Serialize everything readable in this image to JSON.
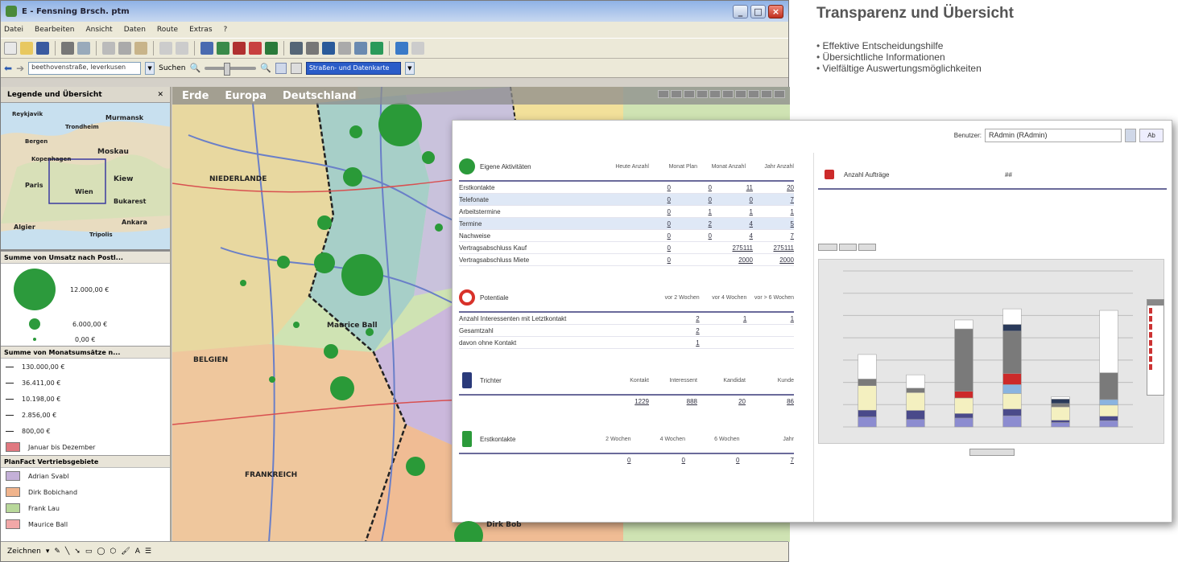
{
  "window": {
    "title": "E - Fensning Brsch. ptm",
    "menu": [
      "Datei",
      "Bearbeiten",
      "Ansicht",
      "Daten",
      "Route",
      "Extras",
      "?"
    ],
    "address_value": "beethovenstraße, leverkusen",
    "search_label": "Suchen",
    "layer_select_value": "Straßen- und Datenkarte"
  },
  "left_panel": {
    "title": "Legende und Übersicht",
    "minimap_labels": [
      "Reykjavik",
      "Murmansk",
      "Trondheim",
      "Bergen",
      "Moskau",
      "Kopenhagen",
      "Kiew",
      "Paris",
      "Wien",
      "Bukarest",
      "Algier",
      "Ankara",
      "Tripolis"
    ],
    "sections": [
      {
        "title": "Summe von Umsatz nach Postl...",
        "items": [
          {
            "label": "12.000,00 €"
          },
          {
            "label": "6.000,00 €"
          },
          {
            "label": "0,00 €"
          }
        ]
      },
      {
        "title": "Summe von Monatsumsätze n...",
        "items": [
          {
            "label": "130.000,00 €"
          },
          {
            "label": "36.411,00 €"
          },
          {
            "label": "10.198,00 €"
          },
          {
            "label": "2.856,00 €"
          },
          {
            "label": "800,00 €"
          },
          {
            "label": "Januar bis Dezember"
          }
        ]
      },
      {
        "title": "PlanFact Vertriebsgebiete",
        "items": [
          {
            "label": "Adrian Svabl",
            "color": "#c4b0d8"
          },
          {
            "label": "Dirk Bobichand",
            "color": "#f0b48c"
          },
          {
            "label": "Frank Lau",
            "color": "#b8d89a"
          },
          {
            "label": "Maurice Ball",
            "color": "#f2a8a8"
          }
        ]
      }
    ]
  },
  "map": {
    "breadcrumb": [
      "Erde",
      "Europa",
      "Deutschland"
    ],
    "labels": [
      "NIEDERLANDE",
      "BELGIEN",
      "FRANKREICH",
      "Maurice Ball",
      "Dirk Bob"
    ]
  },
  "drawbar_label": "Zeichnen",
  "heading": "Transparenz und Übersicht",
  "bullets": [
    "Effektive Entscheidungshilfe",
    "Übersichtliche Informationen",
    "Vielfältige Auswertungsmöglichkeiten"
  ],
  "dashboard": {
    "user_label": "Benutzer:",
    "user_value": "RAdmin (RAdmin)",
    "logout_label": "Ab",
    "blocks": [
      {
        "title": "Eigene Aktivitäten",
        "icon_color": "#2b9a3a",
        "columns": [
          "Heute Anzahl",
          "Monat Plan",
          "Monat Anzahl",
          "Jahr Anzahl"
        ],
        "rows": [
          {
            "label": "Erstkontakte",
            "values": [
              "0",
              "0",
              "11",
              "20"
            ]
          },
          {
            "label": "Telefonate",
            "values": [
              "0",
              "0",
              "0",
              "7"
            ]
          },
          {
            "label": "Arbeitstermine",
            "values": [
              "0",
              "1",
              "1",
              "1"
            ]
          },
          {
            "label": "Termine",
            "values": [
              "0",
              "2",
              "4",
              "5"
            ]
          },
          {
            "label": "Nachweise",
            "values": [
              "0",
              "0",
              "4",
              "7"
            ]
          },
          {
            "label": "Vertragsabschluss Kauf",
            "values": [
              "0",
              "",
              "275111",
              "275111"
            ]
          },
          {
            "label": "Vertragsabschluss Miete",
            "values": [
              "0",
              "",
              "2000",
              "2000"
            ]
          }
        ]
      },
      {
        "title": "Potentiale",
        "icon_color": "#d8322a",
        "columns": [
          "vor 2 Wochen",
          "vor 4 Wochen",
          "vor > 6 Wochen"
        ],
        "rows": [
          {
            "label": "Anzahl Interessenten mit Letztkontakt",
            "values": [
              "2",
              "1",
              "1"
            ]
          },
          {
            "label": "Gesamtzahl",
            "values": [
              "2",
              "",
              ""
            ]
          },
          {
            "label": "davon ohne Kontakt",
            "values": [
              "1",
              "",
              ""
            ]
          }
        ]
      },
      {
        "title": "Trichter",
        "icon_color": "#2a3a7a",
        "columns": [
          "Kontakt",
          "Interessent",
          "Kandidat",
          "Kunde"
        ],
        "rows": [
          {
            "label": "",
            "values": [
              "1229",
              "888",
              "20",
              "86"
            ]
          }
        ]
      },
      {
        "title": "Erstkontakte",
        "icon_color": "#2b9a3a",
        "columns": [
          "2 Wochen",
          "4 Wochen",
          "6 Wochen",
          "Jahr"
        ],
        "rows": [
          {
            "label": "",
            "values": [
              "0",
              "0",
              "0",
              "7"
            ]
          }
        ]
      }
    ],
    "chart_title": "Anzahl Aufträge",
    "chart_value": "##",
    "chart_data": {
      "type": "bar",
      "stacked": true,
      "categories": [
        "",
        "",
        "",
        "",
        "",
        ""
      ],
      "series": [
        {
          "values": [
            4500,
            3400,
            4000,
            5000,
            2000,
            2800
          ],
          "color": "#8c8cd0"
        },
        {
          "values": [
            3000,
            4000,
            2000,
            3000,
            1000,
            2000
          ],
          "color": "#4a4a8a"
        },
        {
          "values": [
            11000,
            8000,
            7000,
            7000,
            6000,
            5000
          ],
          "color": "#f4f0c0"
        },
        {
          "values": [
            0,
            0,
            0,
            4000,
            0,
            2500
          ],
          "color": "#8ab4e0"
        },
        {
          "values": [
            0,
            0,
            3000,
            5000,
            0,
            0
          ],
          "color": "#cc2a2a"
        },
        {
          "values": [
            3000,
            2000,
            28000,
            19000,
            1500,
            12000
          ],
          "color": "#7a7a7a"
        },
        {
          "values": [
            0,
            0,
            0,
            3000,
            2000,
            0
          ],
          "color": "#2a3a5a"
        },
        {
          "values": [
            11000,
            6000,
            4000,
            7000,
            1000,
            28000
          ],
          "color": "#ffffff"
        }
      ],
      "ylim": [
        0,
        70000
      ]
    }
  }
}
